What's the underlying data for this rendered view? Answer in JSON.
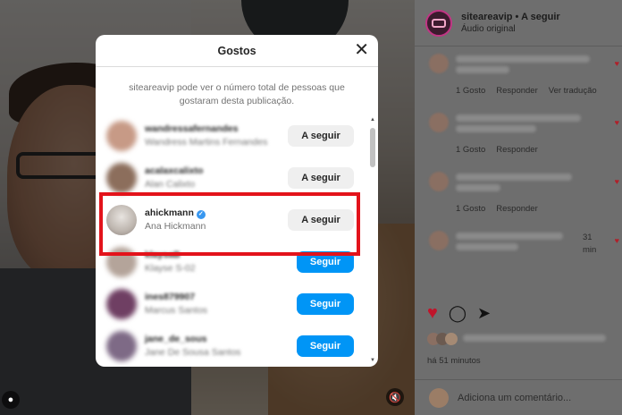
{
  "post": {
    "account": "siteareavip",
    "follow_state": "A seguir",
    "separator": "•",
    "audio": "Áudio original",
    "time_ago": "há 51 minutos",
    "comment_placeholder": "Adiciona um comentário...",
    "comments": [
      {
        "meta": [
          "1 Gosto",
          "Responder",
          "Ver tradução"
        ]
      },
      {
        "meta": [
          "1 Gosto",
          "Responder"
        ]
      },
      {
        "meta": [
          "1 Gosto",
          "Responder"
        ]
      },
      {
        "meta": []
      }
    ],
    "minutes_label": "31",
    "min_label": "min"
  },
  "modal": {
    "title": "Gostos",
    "notice": "siteareavip pode ver o número total de pessoas que gostaram desta publicação.",
    "users": [
      {
        "username": "wandressafernandes",
        "fullname": "Wandress Martins Fernandes",
        "button": "A seguir",
        "state": "following",
        "blurred": true
      },
      {
        "username": "acalaxcalixto",
        "fullname": "Alan Calixto",
        "button": "A seguir",
        "state": "following",
        "blurred": true
      },
      {
        "username": "ahickmann",
        "fullname": "Ana Hickmann",
        "button": "A seguir",
        "state": "following",
        "blurred": false,
        "verified": true
      },
      {
        "username": "klaysaB",
        "fullname": "Klayse S-02",
        "button": "Seguir",
        "state": "follow",
        "blurred": true
      },
      {
        "username": "ines879907",
        "fullname": "Marcus Santos",
        "button": "Seguir",
        "state": "follow",
        "blurred": true
      },
      {
        "username": "jane_de_sous",
        "fullname": "Jane De Sousa Santos",
        "button": "Seguir",
        "state": "follow",
        "blurred": true
      }
    ]
  },
  "colors": {
    "highlight": "#e3131b",
    "follow_button": "#0095f6",
    "like_heart": "#c0142a"
  }
}
